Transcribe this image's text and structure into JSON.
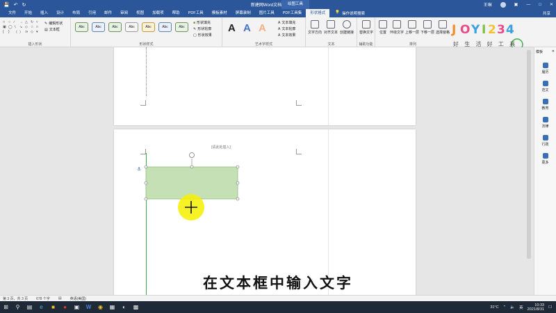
{
  "title_bar": {
    "document_title": "新建网Word文档.docx - Word",
    "context_tool": "绘图工具",
    "user_name": "王琳"
  },
  "tabs": [
    "文件",
    "开始",
    "插入",
    "设计",
    "布局",
    "引用",
    "邮件",
    "审阅",
    "视图",
    "加载项",
    "帮助",
    "PDF工具",
    "模板素材",
    "屏幕录制",
    "图片工具",
    "PDF工具集",
    "形状格式"
  ],
  "active_tab": "形状格式",
  "search": {
    "label": "操作说明搜索"
  },
  "share_label": "共享",
  "ribbon": {
    "insert_shapes": {
      "label": "插入形状",
      "edit_shape": "编辑形状",
      "text_box": "文本框"
    },
    "shape_styles": {
      "label": "形状样式",
      "style_label": "Abc",
      "fill": "形状填充",
      "outline": "形状轮廓",
      "effects": "形状效果"
    },
    "wordart_styles": {
      "label": "艺术字样式",
      "sample": "A",
      "text_fill": "文本填充",
      "text_outline": "文本轮廓",
      "text_effects": "文本效果"
    },
    "text": {
      "label": "文本",
      "direction": "文字方向",
      "align": "对齐文本",
      "link": "创建链接"
    },
    "accessibility": {
      "label": "辅助功能",
      "alt_text": "替换文字"
    },
    "arrange": {
      "label": "排列",
      "position": "位置",
      "wrap": "环绕文字",
      "forward": "上移一层",
      "backward": "下移一层",
      "selection_pane": "选择窗格"
    }
  },
  "logo": {
    "text": "JOYI234",
    "sub": "好 生 活 好 工 具"
  },
  "document": {
    "text_box_hint": "[请此处插入]"
  },
  "pane": {
    "title": "模板",
    "items": [
      "履历",
      "范文",
      "教育",
      "法律",
      "行政",
      "更多"
    ]
  },
  "status": {
    "page": "第 3 页，共 3 页",
    "words": "678 个字",
    "lang": "英语(美国)"
  },
  "taskbar": {
    "weather": "31°C",
    "time": "10:33",
    "date": "2021/8/31",
    "ime": "英"
  },
  "subtitle": "在文本框中输入文字",
  "colors": {
    "ribbon_blue": "#2b579a",
    "textbox_fill": "#c5e0b4",
    "textbox_border": "#8fbf78",
    "cursor_highlight": "#f6f000",
    "guide_green": "#3cb043"
  }
}
